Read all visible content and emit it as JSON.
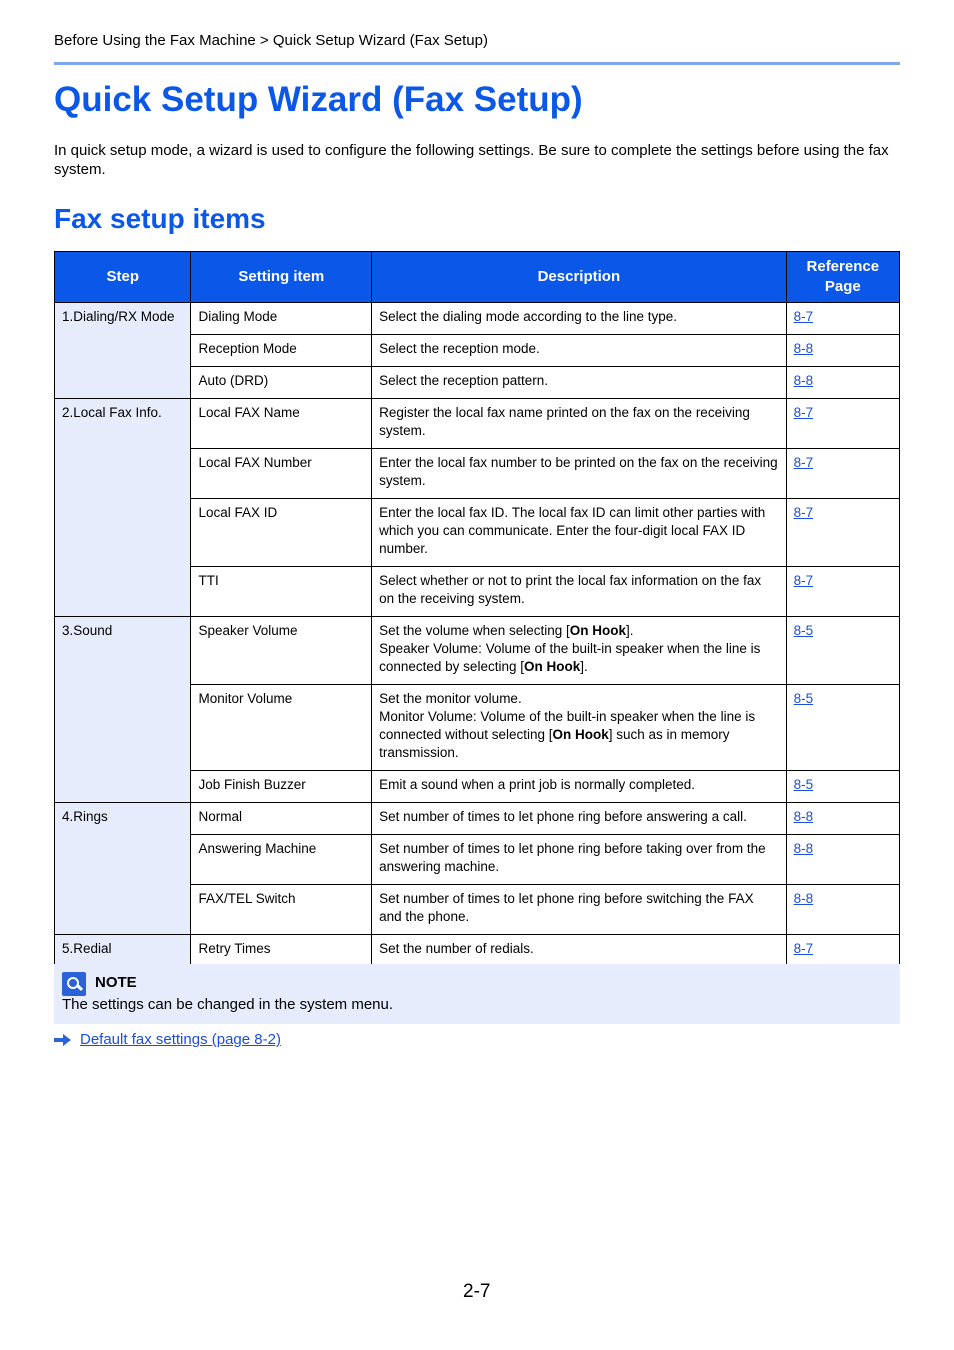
{
  "breadcrumb": "Before Using the Fax Machine > Quick Setup Wizard (Fax Setup)",
  "title": "Quick Setup Wizard (Fax Setup)",
  "intro": "In quick setup mode, a wizard is used to configure the following settings. Be sure to complete the settings before using the fax system.",
  "section_title": "Fax setup items",
  "table": {
    "headers": [
      "Step",
      "Setting item",
      "Description",
      "Reference Page"
    ],
    "groups": [
      {
        "step": "1.Dialing/RX Mode",
        "rows": [
          {
            "item": "Dialing Mode",
            "desc": "Select the dialing mode according to the line type.",
            "ref": "8-7"
          },
          {
            "item": "Reception Mode",
            "desc": "Select the reception mode.",
            "ref": "8-8"
          },
          {
            "item": "Auto (DRD)",
            "desc": "Select the reception pattern.",
            "ref": "8-8"
          }
        ]
      },
      {
        "step": "2.Local Fax Info.",
        "rows": [
          {
            "item": "Local FAX Name",
            "desc": "Register the local fax name printed on the fax on the receiving system.",
            "ref": "8-7"
          },
          {
            "item": "Local FAX Number",
            "desc": "Enter the local fax number to be printed on the fax on the receiving system.",
            "ref": "8-7"
          },
          {
            "item": "Local FAX ID",
            "desc": "Enter the local fax ID. The local fax ID can limit other parties with which you can communicate. Enter the four-digit local FAX ID number.",
            "ref": "8-7"
          },
          {
            "item": "TTI",
            "desc": "Select whether or not to print the local fax information on the fax on the receiving system.",
            "ref": "8-7"
          }
        ]
      },
      {
        "step": "3.Sound",
        "rows": [
          {
            "item": "Speaker Volume",
            "desc_parts": [
              "Set the volume when selecting [",
              "On Hook",
              "].",
              "Speaker Volume: Volume of the built-in speaker when the line is connected by selecting [",
              "On Hook",
              "]."
            ],
            "ref": "8-5"
          },
          {
            "item": "Monitor Volume",
            "desc_parts": [
              "Set the monitor volume.",
              "Monitor Volume: Volume of the built-in speaker when the line is connected without selecting [",
              "On Hook",
              "] such as in memory transmission."
            ],
            "ref": "8-5"
          },
          {
            "item": "Job Finish Buzzer",
            "desc": "Emit a sound when a print job is normally completed.",
            "ref": "8-5"
          }
        ]
      },
      {
        "step": "4.Rings",
        "rows": [
          {
            "item": "Normal",
            "desc": "Set number of times to let phone ring before answering a call.",
            "ref": "8-8"
          },
          {
            "item": "Answering Machine",
            "desc": "Set number of times to let phone ring before taking over from the answering machine.",
            "ref": "8-8"
          },
          {
            "item": "FAX/TEL Switch",
            "desc": "Set number of times to let phone ring before switching the FAX and the phone.",
            "ref": "8-8"
          }
        ]
      },
      {
        "step": "5.Redial",
        "rows": [
          {
            "item": "Retry Times",
            "desc": "Set the number of redials.",
            "ref": "8-7"
          }
        ]
      }
    ]
  },
  "note": {
    "icon": "note-icon",
    "label": "NOTE",
    "text": "The settings can be changed in the system menu."
  },
  "link": {
    "icon": "arrow-right-icon",
    "text": "Default fax settings (page 8-2)"
  },
  "page_number": "2-7"
}
